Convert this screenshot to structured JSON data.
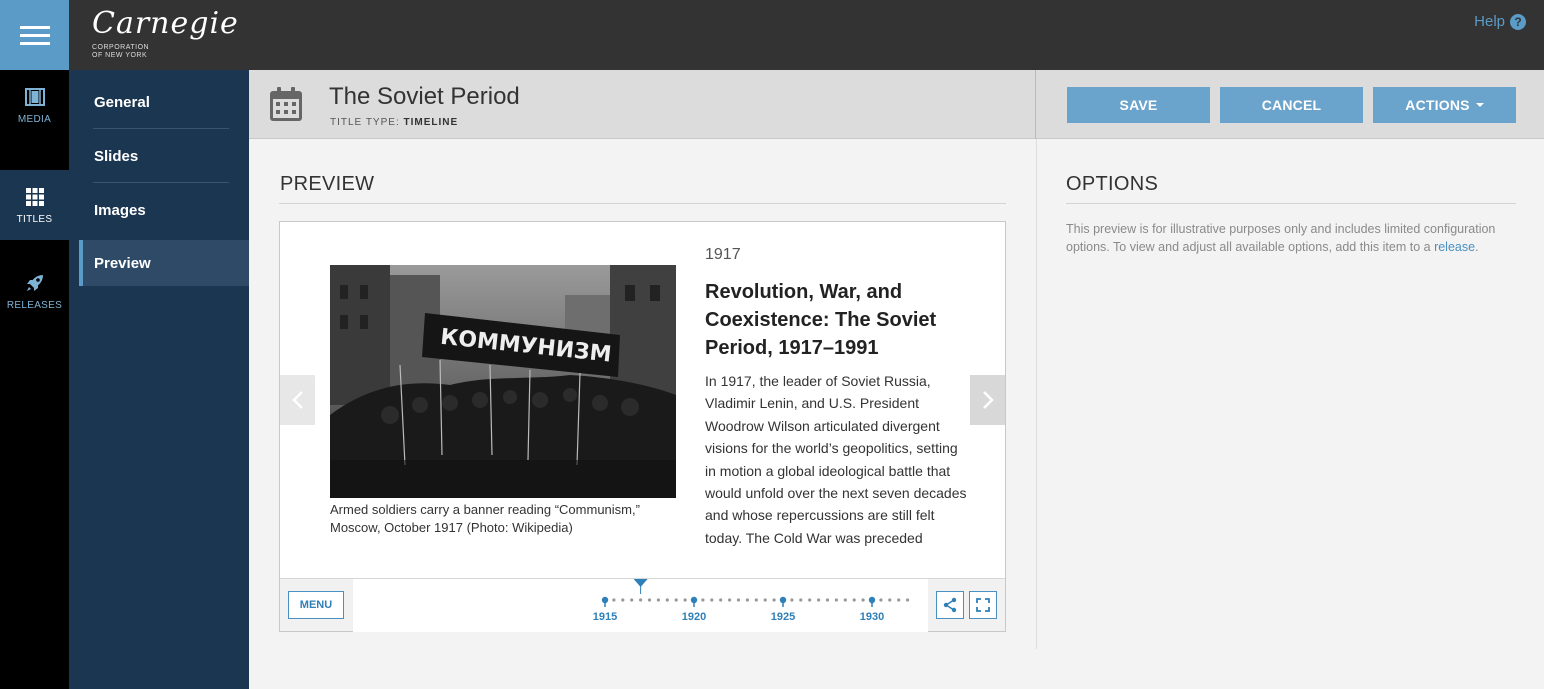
{
  "app": {
    "logo_script": "Carnegie",
    "logo_sub_1": "CORPORATION",
    "logo_sub_2": "OF NEW YORK",
    "help_label": "Help",
    "help_icon": "question-circle-icon"
  },
  "rail": {
    "items": [
      {
        "label": "MEDIA",
        "icon": "film-icon"
      },
      {
        "label": "TITLES",
        "icon": "grid-icon"
      },
      {
        "label": "RELEASES",
        "icon": "rocket-icon"
      }
    ]
  },
  "subnav": {
    "items": [
      {
        "label": "General"
      },
      {
        "label": "Slides"
      },
      {
        "label": "Images"
      },
      {
        "label": "Preview"
      }
    ]
  },
  "header": {
    "title": "The Soviet Period",
    "title_type_label": "TITLE TYPE:",
    "title_type_value": "TIMELINE",
    "save_label": "SAVE",
    "cancel_label": "CANCEL",
    "actions_label": "ACTIONS"
  },
  "preview": {
    "heading": "PREVIEW",
    "year": "1917",
    "slide_title": "Revolution, War, and Coexistence: The Soviet Period, 1917–1991",
    "body": "In 1917, the leader of Soviet Russia, Vladimir Lenin, and U.S. President Woodrow Wilson articulated divergent visions for the world’s geopolitics, setting in motion a global ideological battle that would unfold over the next seven decades and whose repercussions are still felt today. The Cold War was preceded",
    "caption": "Armed soldiers carry a banner reading “Communism,” Moscow, October 1917 (Photo: Wikipedia)",
    "photo_banner_text": "КОММУНИЗМ",
    "menu_label": "MENU",
    "timeline_ticks": [
      "1915",
      "1920",
      "1925",
      "1930"
    ],
    "timeline_start_year": 1915,
    "timeline_end_year": 1932,
    "current_year": 1917
  },
  "options": {
    "heading": "OPTIONS",
    "text_before_link": "This preview is for illustrative purposes only and includes limited configuration options. To view and adjust all available options, add this item to a ",
    "link_text": "release",
    "text_after_link": "."
  },
  "colors": {
    "accent": "#5b9bc7",
    "topbar": "#333333",
    "nav": "#1b3651",
    "button": "#6aa3cc",
    "link": "#2f7fb8"
  }
}
